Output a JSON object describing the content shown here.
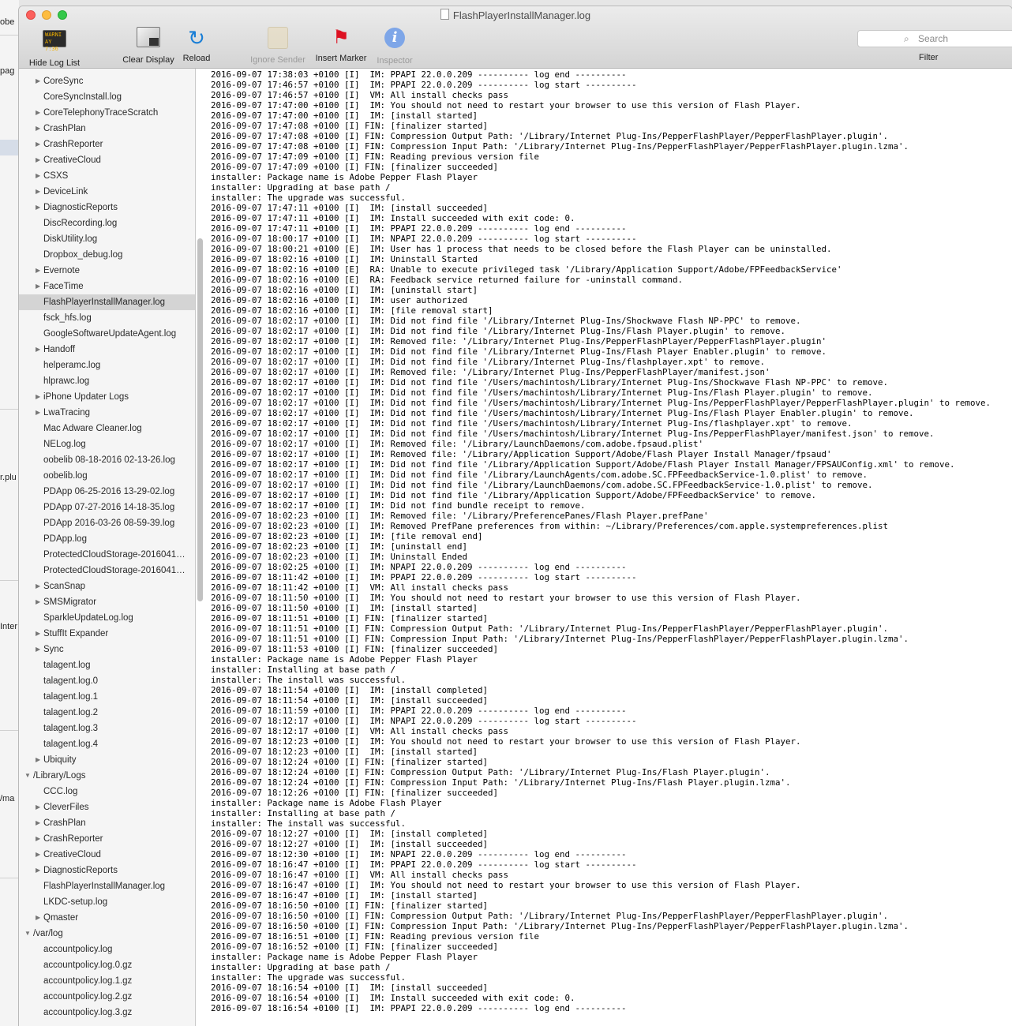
{
  "background_window": {
    "fragments": [
      "obe",
      "pag",
      "r.plu",
      "Inter",
      "/ma"
    ]
  },
  "window": {
    "title": "FlashPlayerInstallManager.log"
  },
  "toolbar": {
    "console_icon_text": [
      "WARNI",
      "AY 7:36"
    ],
    "hide_log_list": "Hide Log List",
    "clear_display": "Clear Display",
    "reload": "Reload",
    "ignore_sender": "Ignore Sender",
    "insert_marker": "Insert Marker",
    "inspector": "Inspector",
    "search_placeholder": "Search",
    "filter": "Filter"
  },
  "sidebar": {
    "items": [
      {
        "label": "CoreSync",
        "type": "folder"
      },
      {
        "label": "CoreSyncInstall.log",
        "type": "file"
      },
      {
        "label": "CoreTelephonyTraceScratch",
        "type": "folder"
      },
      {
        "label": "CrashPlan",
        "type": "folder"
      },
      {
        "label": "CrashReporter",
        "type": "folder"
      },
      {
        "label": "CreativeCloud",
        "type": "folder"
      },
      {
        "label": "CSXS",
        "type": "folder"
      },
      {
        "label": "DeviceLink",
        "type": "folder"
      },
      {
        "label": "DiagnosticReports",
        "type": "folder"
      },
      {
        "label": "DiscRecording.log",
        "type": "file"
      },
      {
        "label": "DiskUtility.log",
        "type": "file"
      },
      {
        "label": "Dropbox_debug.log",
        "type": "file"
      },
      {
        "label": "Evernote",
        "type": "folder"
      },
      {
        "label": "FaceTime",
        "type": "folder"
      },
      {
        "label": "FlashPlayerInstallManager.log",
        "type": "file",
        "selected": true
      },
      {
        "label": "fsck_hfs.log",
        "type": "file"
      },
      {
        "label": "GoogleSoftwareUpdateAgent.log",
        "type": "file"
      },
      {
        "label": "Handoff",
        "type": "folder"
      },
      {
        "label": "helperamc.log",
        "type": "file"
      },
      {
        "label": "hlprawc.log",
        "type": "file"
      },
      {
        "label": "iPhone Updater Logs",
        "type": "folder"
      },
      {
        "label": "LwaTracing",
        "type": "folder"
      },
      {
        "label": "Mac Adware Cleaner.log",
        "type": "file"
      },
      {
        "label": "NELog.log",
        "type": "file"
      },
      {
        "label": "oobelib 08-18-2016 02-13-26.log",
        "type": "file"
      },
      {
        "label": "oobelib.log",
        "type": "file"
      },
      {
        "label": "PDApp 06-25-2016 13-29-02.log",
        "type": "file"
      },
      {
        "label": "PDApp 07-27-2016 14-18-35.log",
        "type": "file"
      },
      {
        "label": "PDApp 2016-03-26 08-59-39.log",
        "type": "file"
      },
      {
        "label": "PDApp.log",
        "type": "file"
      },
      {
        "label": "ProtectedCloudStorage-2016041…",
        "type": "file"
      },
      {
        "label": "ProtectedCloudStorage-2016041…",
        "type": "file"
      },
      {
        "label": "ScanSnap",
        "type": "folder"
      },
      {
        "label": "SMSMigrator",
        "type": "folder"
      },
      {
        "label": "SparkleUpdateLog.log",
        "type": "file"
      },
      {
        "label": "StuffIt Expander",
        "type": "folder"
      },
      {
        "label": "Sync",
        "type": "folder"
      },
      {
        "label": "talagent.log",
        "type": "file"
      },
      {
        "label": "talagent.log.0",
        "type": "file"
      },
      {
        "label": "talagent.log.1",
        "type": "file"
      },
      {
        "label": "talagent.log.2",
        "type": "file"
      },
      {
        "label": "talagent.log.3",
        "type": "file"
      },
      {
        "label": "talagent.log.4",
        "type": "file"
      },
      {
        "label": "Ubiquity",
        "type": "folder"
      },
      {
        "label": "/Library/Logs",
        "type": "root"
      },
      {
        "label": "CCC.log",
        "type": "file"
      },
      {
        "label": "CleverFiles",
        "type": "folder"
      },
      {
        "label": "CrashPlan",
        "type": "folder"
      },
      {
        "label": "CrashReporter",
        "type": "folder"
      },
      {
        "label": "CreativeCloud",
        "type": "folder"
      },
      {
        "label": "DiagnosticReports",
        "type": "folder"
      },
      {
        "label": "FlashPlayerInstallManager.log",
        "type": "file"
      },
      {
        "label": "LKDC-setup.log",
        "type": "file"
      },
      {
        "label": "Qmaster",
        "type": "folder"
      },
      {
        "label": "/var/log",
        "type": "root"
      },
      {
        "label": "accountpolicy.log",
        "type": "file"
      },
      {
        "label": "accountpolicy.log.0.gz",
        "type": "file"
      },
      {
        "label": "accountpolicy.log.1.gz",
        "type": "file"
      },
      {
        "label": "accountpolicy.log.2.gz",
        "type": "file"
      },
      {
        "label": "accountpolicy.log.3.gz",
        "type": "file"
      }
    ]
  },
  "log": {
    "lines": [
      "2016-09-07 17:38:03 +0100 [I]  IM: PPAPI 22.0.0.209 ---------- log end ----------",
      "2016-09-07 17:46:57 +0100 [I]  IM: PPAPI 22.0.0.209 ---------- log start ----------",
      "2016-09-07 17:46:57 +0100 [I]  VM: All install checks pass",
      "2016-09-07 17:47:00 +0100 [I]  IM: You should not need to restart your browser to use this version of Flash Player.",
      "2016-09-07 17:47:00 +0100 [I]  IM: [install started]",
      "2016-09-07 17:47:08 +0100 [I] FIN: [finalizer started]",
      "2016-09-07 17:47:08 +0100 [I] FIN: Compression Output Path: '/Library/Internet Plug-Ins/PepperFlashPlayer/PepperFlashPlayer.plugin'.",
      "2016-09-07 17:47:08 +0100 [I] FIN: Compression Input Path: '/Library/Internet Plug-Ins/PepperFlashPlayer/PepperFlashPlayer.plugin.lzma'.",
      "2016-09-07 17:47:09 +0100 [I] FIN: Reading previous version file",
      "2016-09-07 17:47:09 +0100 [I] FIN: [finalizer succeeded]",
      "installer: Package name is Adobe Pepper Flash Player",
      "installer: Upgrading at base path /",
      "installer: The upgrade was successful.",
      "2016-09-07 17:47:11 +0100 [I]  IM: [install succeeded]",
      "2016-09-07 17:47:11 +0100 [I]  IM: Install succeeded with exit code: 0.",
      "2016-09-07 17:47:11 +0100 [I]  IM: PPAPI 22.0.0.209 ---------- log end ----------",
      "2016-09-07 18:00:17 +0100 [I]  IM: NPAPI 22.0.0.209 ---------- log start ----------",
      "2016-09-07 18:00:21 +0100 [E]  IM: User has 1 process that needs to be closed before the Flash Player can be uninstalled.",
      "2016-09-07 18:02:16 +0100 [I]  IM: Uninstall Started",
      "2016-09-07 18:02:16 +0100 [E]  RA: Unable to execute privileged task '/Library/Application Support/Adobe/FPFeedbackService'",
      "2016-09-07 18:02:16 +0100 [E]  RA: Feedback service returned failure for -uninstall command.",
      "2016-09-07 18:02:16 +0100 [I]  IM: [uninstall start]",
      "2016-09-07 18:02:16 +0100 [I]  IM: user authorized",
      "2016-09-07 18:02:16 +0100 [I]  IM: [file removal start]",
      "2016-09-07 18:02:17 +0100 [I]  IM: Did not find file '/Library/Internet Plug-Ins/Shockwave Flash NP-PPC' to remove.",
      "2016-09-07 18:02:17 +0100 [I]  IM: Did not find file '/Library/Internet Plug-Ins/Flash Player.plugin' to remove.",
      "2016-09-07 18:02:17 +0100 [I]  IM: Removed file: '/Library/Internet Plug-Ins/PepperFlashPlayer/PepperFlashPlayer.plugin'",
      "2016-09-07 18:02:17 +0100 [I]  IM: Did not find file '/Library/Internet Plug-Ins/Flash Player Enabler.plugin' to remove.",
      "2016-09-07 18:02:17 +0100 [I]  IM: Did not find file '/Library/Internet Plug-Ins/flashplayer.xpt' to remove.",
      "2016-09-07 18:02:17 +0100 [I]  IM: Removed file: '/Library/Internet Plug-Ins/PepperFlashPlayer/manifest.json'",
      "2016-09-07 18:02:17 +0100 [I]  IM: Did not find file '/Users/machintosh/Library/Internet Plug-Ins/Shockwave Flash NP-PPC' to remove.",
      "2016-09-07 18:02:17 +0100 [I]  IM: Did not find file '/Users/machintosh/Library/Internet Plug-Ins/Flash Player.plugin' to remove.",
      "2016-09-07 18:02:17 +0100 [I]  IM: Did not find file '/Users/machintosh/Library/Internet Plug-Ins/PepperFlashPlayer/PepperFlashPlayer.plugin' to remove.",
      "2016-09-07 18:02:17 +0100 [I]  IM: Did not find file '/Users/machintosh/Library/Internet Plug-Ins/Flash Player Enabler.plugin' to remove.",
      "2016-09-07 18:02:17 +0100 [I]  IM: Did not find file '/Users/machintosh/Library/Internet Plug-Ins/flashplayer.xpt' to remove.",
      "2016-09-07 18:02:17 +0100 [I]  IM: Did not find file '/Users/machintosh/Library/Internet Plug-Ins/PepperFlashPlayer/manifest.json' to remove.",
      "2016-09-07 18:02:17 +0100 [I]  IM: Removed file: '/Library/LaunchDaemons/com.adobe.fpsaud.plist'",
      "2016-09-07 18:02:17 +0100 [I]  IM: Removed file: '/Library/Application Support/Adobe/Flash Player Install Manager/fpsaud'",
      "2016-09-07 18:02:17 +0100 [I]  IM: Did not find file '/Library/Application Support/Adobe/Flash Player Install Manager/FPSAUConfig.xml' to remove.",
      "2016-09-07 18:02:17 +0100 [I]  IM: Did not find file '/Library/LaunchAgents/com.adobe.SC.FPFeedbackService-1.0.plist' to remove.",
      "2016-09-07 18:02:17 +0100 [I]  IM: Did not find file '/Library/LaunchDaemons/com.adobe.SC.FPFeedbackService-1.0.plist' to remove.",
      "2016-09-07 18:02:17 +0100 [I]  IM: Did not find file '/Library/Application Support/Adobe/FPFeedbackService' to remove.",
      "2016-09-07 18:02:17 +0100 [I]  IM: Did not find bundle receipt to remove.",
      "2016-09-07 18:02:23 +0100 [I]  IM: Removed file: '/Library/PreferencePanes/Flash Player.prefPane'",
      "2016-09-07 18:02:23 +0100 [I]  IM: Removed PrefPane preferences from within: ~/Library/Preferences/com.apple.systempreferences.plist",
      "2016-09-07 18:02:23 +0100 [I]  IM: [file removal end]",
      "2016-09-07 18:02:23 +0100 [I]  IM: [uninstall end]",
      "2016-09-07 18:02:23 +0100 [I]  IM: Uninstall Ended",
      "2016-09-07 18:02:25 +0100 [I]  IM: NPAPI 22.0.0.209 ---------- log end ----------",
      "2016-09-07 18:11:42 +0100 [I]  IM: PPAPI 22.0.0.209 ---------- log start ----------",
      "2016-09-07 18:11:42 +0100 [I]  VM: All install checks pass",
      "2016-09-07 18:11:50 +0100 [I]  IM: You should not need to restart your browser to use this version of Flash Player.",
      "2016-09-07 18:11:50 +0100 [I]  IM: [install started]",
      "2016-09-07 18:11:51 +0100 [I] FIN: [finalizer started]",
      "2016-09-07 18:11:51 +0100 [I] FIN: Compression Output Path: '/Library/Internet Plug-Ins/PepperFlashPlayer/PepperFlashPlayer.plugin'.",
      "2016-09-07 18:11:51 +0100 [I] FIN: Compression Input Path: '/Library/Internet Plug-Ins/PepperFlashPlayer/PepperFlashPlayer.plugin.lzma'.",
      "2016-09-07 18:11:53 +0100 [I] FIN: [finalizer succeeded]",
      "installer: Package name is Adobe Pepper Flash Player",
      "installer: Installing at base path /",
      "installer: The install was successful.",
      "2016-09-07 18:11:54 +0100 [I]  IM: [install completed]",
      "2016-09-07 18:11:54 +0100 [I]  IM: [install succeeded]",
      "2016-09-07 18:11:59 +0100 [I]  IM: PPAPI 22.0.0.209 ---------- log end ----------",
      "2016-09-07 18:12:17 +0100 [I]  IM: NPAPI 22.0.0.209 ---------- log start ----------",
      "2016-09-07 18:12:17 +0100 [I]  VM: All install checks pass",
      "2016-09-07 18:12:23 +0100 [I]  IM: You should not need to restart your browser to use this version of Flash Player.",
      "2016-09-07 18:12:23 +0100 [I]  IM: [install started]",
      "2016-09-07 18:12:24 +0100 [I] FIN: [finalizer started]",
      "2016-09-07 18:12:24 +0100 [I] FIN: Compression Output Path: '/Library/Internet Plug-Ins/Flash Player.plugin'.",
      "2016-09-07 18:12:24 +0100 [I] FIN: Compression Input Path: '/Library/Internet Plug-Ins/Flash Player.plugin.lzma'.",
      "2016-09-07 18:12:26 +0100 [I] FIN: [finalizer succeeded]",
      "installer: Package name is Adobe Flash Player",
      "installer: Installing at base path /",
      "installer: The install was successful.",
      "2016-09-07 18:12:27 +0100 [I]  IM: [install completed]",
      "2016-09-07 18:12:27 +0100 [I]  IM: [install succeeded]",
      "2016-09-07 18:12:30 +0100 [I]  IM: NPAPI 22.0.0.209 ---------- log end ----------",
      "2016-09-07 18:16:47 +0100 [I]  IM: PPAPI 22.0.0.209 ---------- log start ----------",
      "2016-09-07 18:16:47 +0100 [I]  VM: All install checks pass",
      "2016-09-07 18:16:47 +0100 [I]  IM: You should not need to restart your browser to use this version of Flash Player.",
      "2016-09-07 18:16:47 +0100 [I]  IM: [install started]",
      "2016-09-07 18:16:50 +0100 [I] FIN: [finalizer started]",
      "2016-09-07 18:16:50 +0100 [I] FIN: Compression Output Path: '/Library/Internet Plug-Ins/PepperFlashPlayer/PepperFlashPlayer.plugin'.",
      "2016-09-07 18:16:50 +0100 [I] FIN: Compression Input Path: '/Library/Internet Plug-Ins/PepperFlashPlayer/PepperFlashPlayer.plugin.lzma'.",
      "2016-09-07 18:16:51 +0100 [I] FIN: Reading previous version file",
      "2016-09-07 18:16:52 +0100 [I] FIN: [finalizer succeeded]",
      "installer: Package name is Adobe Pepper Flash Player",
      "installer: Upgrading at base path /",
      "installer: The upgrade was successful.",
      "2016-09-07 18:16:54 +0100 [I]  IM: [install succeeded]",
      "2016-09-07 18:16:54 +0100 [I]  IM: Install succeeded with exit code: 0.",
      "2016-09-07 18:16:54 +0100 [I]  IM: PPAPI 22.0.0.209 ---------- log end ----------"
    ]
  }
}
